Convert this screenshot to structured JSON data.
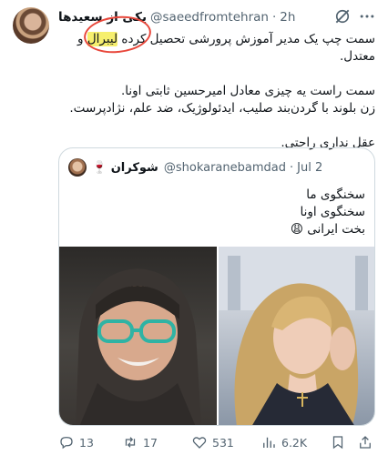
{
  "tweet": {
    "display_name": "یکی از سعیدها",
    "handle": "@saeedfromtehran",
    "dot": "·",
    "time": "2h",
    "text_lines": [
      {
        "before": "سمت چپ یک مدیر آموزش پرورشی تحصیل کرده ",
        "highlight": "لیبرال",
        "after": " و معتدل."
      },
      {
        "text": "سمت راست یه چیزی معادل امیرحسین ثابتی اونا."
      },
      {
        "text": "زن بلوند با گردن‌بند صلیب، ایدئولوژیک، ضد علم، نژادپرست."
      },
      {
        "text": "عقل نداری راحتی."
      }
    ],
    "annotation_color": "#e8473b",
    "highlight_color": "#f6ef6e"
  },
  "quote": {
    "display_name": "شوکران 🍷",
    "handle": "@shokaranebamdad",
    "dot": "·",
    "time": "Jul 2",
    "lines": [
      "سخنگوی ما",
      "سخنگوی اونا",
      "بخت ایرانی 😩"
    ]
  },
  "actions": {
    "replies": "13",
    "retweets": "17",
    "likes": "531",
    "views": "6.2K"
  },
  "colors": {
    "text": "#0f1419",
    "secondary": "#536471",
    "border": "#cfd9de"
  }
}
